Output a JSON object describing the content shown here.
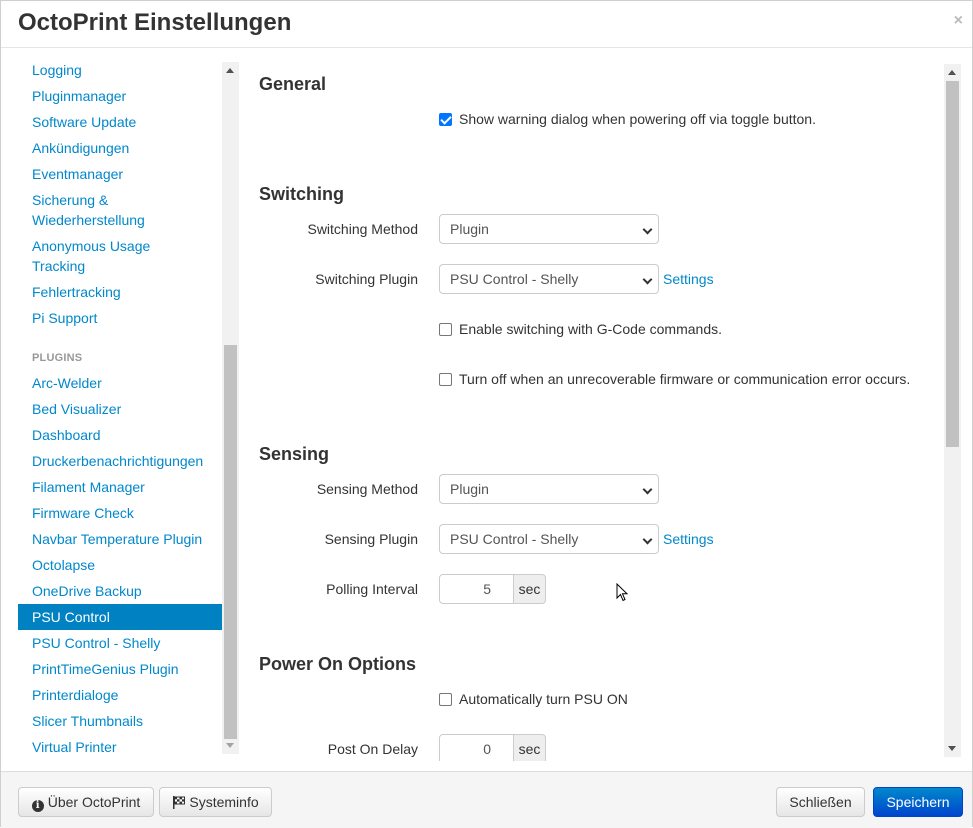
{
  "dialog": {
    "title": "OctoPrint Einstellungen",
    "close_glyph": "×"
  },
  "sidebar": {
    "items_top": [
      "Logging",
      "Pluginmanager",
      "Software Update",
      "Ankündigungen",
      "Eventmanager",
      "Sicherung & Wiederherstellung",
      "Anonymous Usage Tracking",
      "Fehlertracking",
      "Pi Support"
    ],
    "plugins_header": "PLUGINS",
    "plugins": [
      "Arc-Welder",
      "Bed Visualizer",
      "Dashboard",
      "Druckerbenachrichtigungen",
      "Filament Manager",
      "Firmware Check",
      "Navbar Temperature Plugin",
      "Octolapse",
      "OneDrive Backup",
      "PSU Control",
      "PSU Control - Shelly",
      "PrintTimeGenius Plugin",
      "Printerdialoge",
      "Slicer Thumbnails",
      "Virtual Printer"
    ],
    "active_item": "PSU Control"
  },
  "general": {
    "title": "General",
    "warning_dialog_label": "Show warning dialog when powering off via toggle button.",
    "warning_dialog_checked": true
  },
  "switching": {
    "title": "Switching",
    "method_label": "Switching Method",
    "method_value": "Plugin",
    "plugin_label": "Switching Plugin",
    "plugin_value": "PSU Control - Shelly",
    "settings_link": "Settings",
    "gcode_label": "Enable switching with G-Code commands.",
    "gcode_checked": false,
    "error_label": "Turn off when an unrecoverable firmware or communication error occurs.",
    "error_checked": false
  },
  "sensing": {
    "title": "Sensing",
    "method_label": "Sensing Method",
    "method_value": "Plugin",
    "plugin_label": "Sensing Plugin",
    "plugin_value": "PSU Control - Shelly",
    "settings_link": "Settings",
    "polling_label": "Polling Interval",
    "polling_value": "5",
    "polling_unit": "sec"
  },
  "power_on": {
    "title": "Power On Options",
    "auto_on_label": "Automatically turn PSU ON",
    "auto_on_checked": false,
    "post_delay_label": "Post On Delay",
    "post_delay_value": "0",
    "post_delay_unit": "sec"
  },
  "footer": {
    "about_label": "Über OctoPrint",
    "sysinfo_label": "Systeminfo",
    "close_label": "Schließen",
    "save_label": "Speichern"
  },
  "colors": {
    "link": "#0088cc",
    "active_bg": "#0081c2",
    "primary": "#0055cc"
  }
}
